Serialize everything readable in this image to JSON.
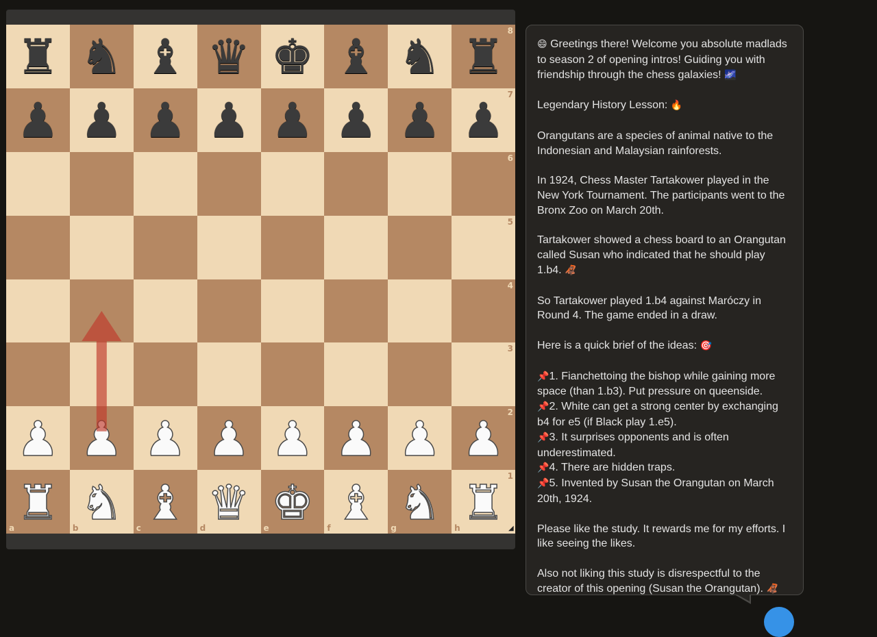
{
  "board": {
    "files": [
      "a",
      "b",
      "c",
      "d",
      "e",
      "f",
      "g",
      "h"
    ],
    "ranks": [
      "8",
      "7",
      "6",
      "5",
      "4",
      "3",
      "2",
      "1"
    ],
    "position": [
      [
        "r",
        "n",
        "b",
        "q",
        "k",
        "b",
        "n",
        "r"
      ],
      [
        "p",
        "p",
        "p",
        "p",
        "p",
        "p",
        "p",
        "p"
      ],
      [
        "",
        "",
        "",
        "",
        "",
        "",
        "",
        ""
      ],
      [
        "",
        "",
        "",
        "",
        "",
        "",
        "",
        ""
      ],
      [
        "",
        "",
        "",
        "",
        "",
        "",
        "",
        ""
      ],
      [
        "",
        "",
        "",
        "",
        "",
        "",
        "",
        ""
      ],
      [
        "P",
        "P",
        "P",
        "P",
        "P",
        "P",
        "P",
        "P"
      ],
      [
        "R",
        "N",
        "B",
        "Q",
        "K",
        "B",
        "N",
        "R"
      ]
    ],
    "arrow": {
      "from": "b2",
      "to": "b4",
      "color": "#c0392b"
    }
  },
  "study": {
    "greeting": "Greetings there! Welcome you absolute madlads to season 2 of opening intros! Guiding you with friendship through the chess galaxies!",
    "greeting_emoji_start": "😄",
    "greeting_emoji_end": "🌌",
    "history_heading": "Legendary History Lesson:",
    "history_emoji": "🔥",
    "para1": "Orangutans are a species of animal native to the Indonesian and Malaysian rainforests.",
    "para2": "In 1924, Chess Master Tartakower played in the New York Tournament. The participants went to the Bronx Zoo on March 20th.",
    "para3": "Tartakower showed a chess board to an Orangutan called Susan who indicated that he should play 1.b4.",
    "para3_emoji": "🦧",
    "para4": "So Tartakower played 1.b4 against Maróczy in Round 4. The game ended in a draw.",
    "ideas_heading": "Here is a quick brief of the ideas:",
    "ideas_emoji": "🎯",
    "pin_emoji": "📌",
    "ideas": [
      "1. Fianchettoing the bishop while gaining more space (than 1.b3). Put pressure on queenside.",
      "2. White can get a strong center by exchanging b4 for e5 (if Black play 1.e5).",
      "3. It surprises opponents and is often underestimated.",
      "4. There are hidden traps.",
      "5. Invented by Susan the Orangutan on March 20th, 1924."
    ],
    "like_para": "Please like the study. It rewards me for my efforts. I like seeing the likes.",
    "final_para": "Also not liking this study is disrespectful to the creator of this opening (Susan the Orangutan).",
    "final_emoji": "🦧"
  }
}
